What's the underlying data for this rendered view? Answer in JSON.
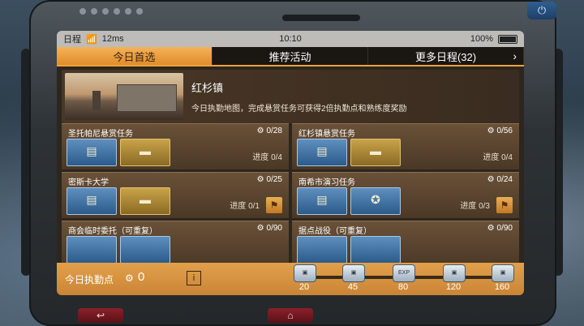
{
  "status": {
    "left_label": "日程",
    "signal": "12ms",
    "time": "10:10",
    "battery": "100%"
  },
  "tabs": [
    {
      "label": "今日首选"
    },
    {
      "label": "推荐活动"
    },
    {
      "label": "更多日程(32)"
    }
  ],
  "banner": {
    "title": "红杉镇",
    "desc": "今日执勤地图，完成悬赏任务可获得2倍执勤点和熟练度奖励"
  },
  "cards": [
    {
      "title": "圣托帕尼悬赏任务",
      "count": "0/28",
      "progress": "进度 0/4",
      "items": [
        "blue",
        "gold"
      ]
    },
    {
      "title": "红杉镇悬赏任务",
      "count": "0/56",
      "progress": "进度 0/4",
      "items": [
        "blue",
        "gold"
      ]
    },
    {
      "title": "密斯卡大学",
      "count": "0/25",
      "progress": "进度 0/1",
      "items": [
        "blue",
        "gold"
      ]
    },
    {
      "title": "南希市演习任务",
      "count": "0/24",
      "progress": "进度 0/3",
      "items": [
        "blue",
        "blue"
      ]
    },
    {
      "title": "商会临时委托（可重复）",
      "count": "0/90",
      "progress": "",
      "items": [
        "blue",
        "blue"
      ]
    },
    {
      "title": "据点战役（可重复）",
      "count": "0/90",
      "progress": "",
      "items": [
        "blue",
        "gold"
      ]
    }
  ],
  "bottom": {
    "points_label": "今日执勤点",
    "points_value": "0",
    "info_label": "i",
    "milestones": [
      "20",
      "45",
      "80",
      "120",
      "160"
    ],
    "chest_exp_label": "EXP"
  },
  "nav": {
    "back": "↩",
    "home": "⌂"
  },
  "icons": {
    "power": "power-icon",
    "wifi": "wifi-icon",
    "chevron": "chevron-right-icon"
  }
}
